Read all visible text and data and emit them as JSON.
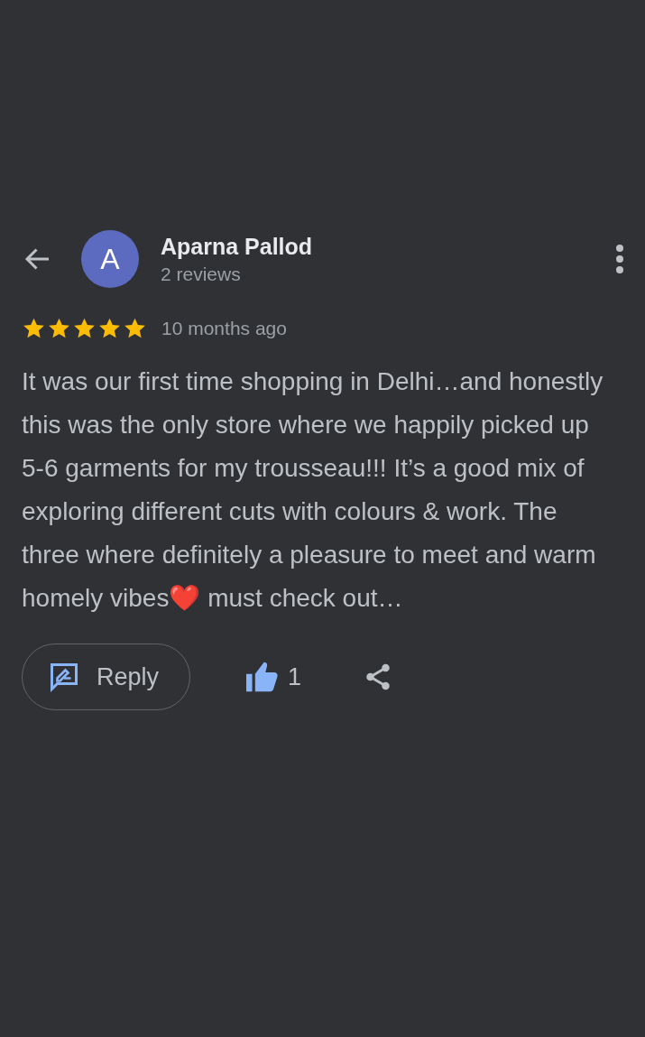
{
  "reviewer": {
    "initial": "A",
    "name": "Aparna Pallod",
    "subtitle": "2 reviews"
  },
  "review": {
    "stars": 5,
    "time": "10 months ago",
    "text": "It was our first time shopping in Delhi…and honestly this was the only store where we happily picked up 5-6 garments for my trousseau!!! It’s a good mix of exploring different cuts with colours & work. The three where definitely a pleasure to meet and warm homely vibes❤️ must check out…"
  },
  "actions": {
    "reply_label": "Reply",
    "liked": true,
    "like_count": "1"
  }
}
